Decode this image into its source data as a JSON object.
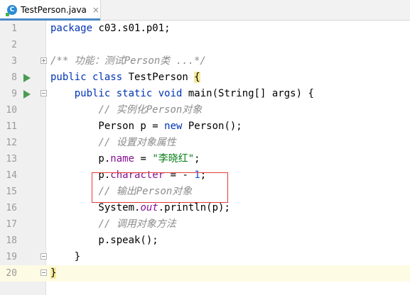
{
  "tab": {
    "icon_letter": "C",
    "title": "TestPerson.java",
    "close": "×"
  },
  "lines": [
    {
      "n": "1",
      "segs": [
        [
          "kw",
          "package"
        ],
        [
          "t",
          " c03.s01.p01;"
        ]
      ]
    },
    {
      "n": "2",
      "segs": []
    },
    {
      "n": "3",
      "segs": [
        [
          "cm",
          "/** 功能：测试Person类 ...*/"
        ]
      ]
    },
    {
      "n": "8",
      "segs": [
        [
          "kw",
          "public class "
        ],
        [
          "t",
          "TestPerson "
        ],
        [
          "brace",
          "{"
        ]
      ]
    },
    {
      "n": "9",
      "segs": [
        [
          "t",
          "    "
        ],
        [
          "kw",
          "public static void "
        ],
        [
          "t",
          "main(String[] args) {"
        ]
      ]
    },
    {
      "n": "10",
      "segs": [
        [
          "t",
          "        "
        ],
        [
          "cm",
          "// 实例化Person对象"
        ]
      ]
    },
    {
      "n": "11",
      "segs": [
        [
          "t",
          "        Person p = "
        ],
        [
          "kw",
          "new "
        ],
        [
          "t",
          "Person();"
        ]
      ]
    },
    {
      "n": "12",
      "segs": [
        [
          "t",
          "        "
        ],
        [
          "cm",
          "// 设置对象属性"
        ]
      ]
    },
    {
      "n": "13",
      "segs": [
        [
          "t",
          "        p."
        ],
        [
          "fd",
          "name"
        ],
        [
          "t",
          " = "
        ],
        [
          "st",
          "\"李晓红\""
        ],
        [
          "t",
          ";"
        ]
      ]
    },
    {
      "n": "14",
      "segs": [
        [
          "t",
          "        p."
        ],
        [
          "fd",
          "character"
        ],
        [
          "t",
          " = - "
        ],
        [
          "num",
          "1"
        ],
        [
          "t",
          ";"
        ]
      ]
    },
    {
      "n": "15",
      "segs": [
        [
          "t",
          "        "
        ],
        [
          "cm",
          "// 输出Person对象"
        ]
      ]
    },
    {
      "n": "16",
      "segs": [
        [
          "t",
          "        System."
        ],
        [
          "it",
          "out"
        ],
        [
          "t",
          ".println(p);"
        ]
      ]
    },
    {
      "n": "17",
      "segs": [
        [
          "t",
          "        "
        ],
        [
          "cm",
          "// 调用对象方法"
        ]
      ]
    },
    {
      "n": "18",
      "segs": [
        [
          "t",
          "        p.speak();"
        ]
      ]
    },
    {
      "n": "19",
      "segs": [
        [
          "t",
          "    }"
        ]
      ]
    },
    {
      "n": "20",
      "segs": [
        [
          "brace",
          "}"
        ]
      ]
    }
  ],
  "gutter_icons": {
    "run": [
      "8",
      "9"
    ],
    "fold_plus": [
      "3"
    ],
    "fold_minus": [
      "9",
      "19",
      "20"
    ]
  },
  "current_line": "20",
  "colors": {
    "keyword": "#0033b3",
    "comment": "#8c8c8c",
    "string": "#067d17",
    "field": "#871094",
    "number": "#1750eb",
    "highlight_box": "#e23b3b"
  }
}
